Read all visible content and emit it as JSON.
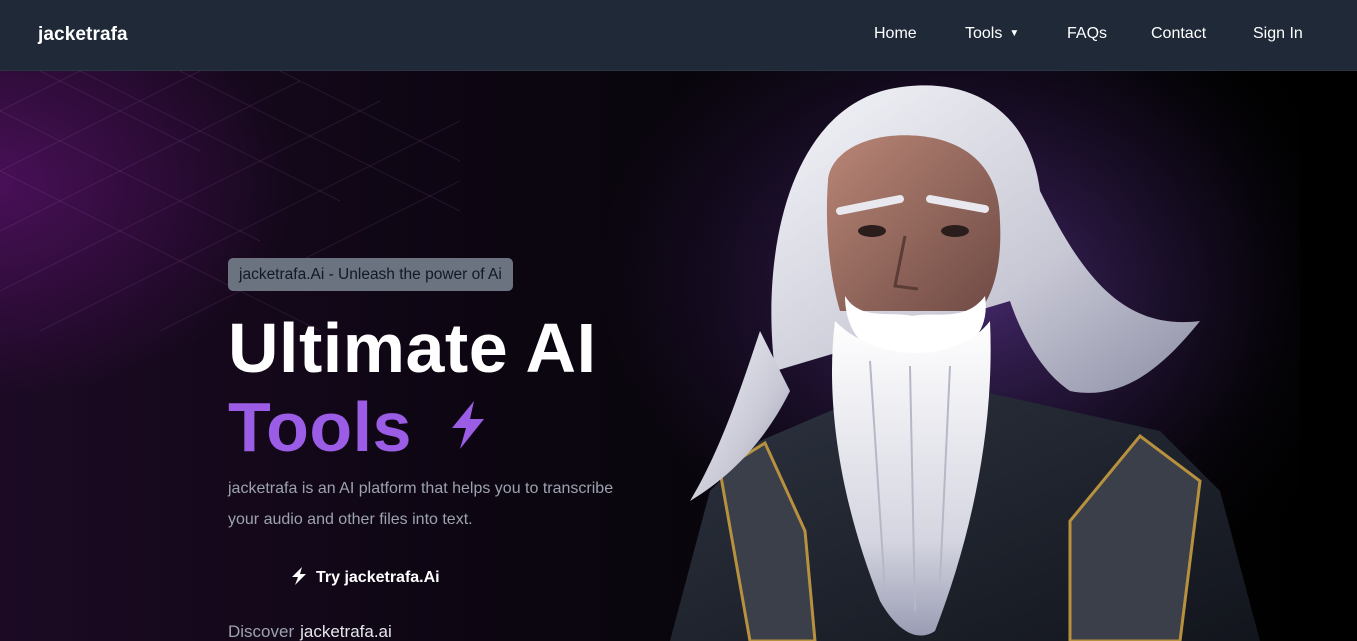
{
  "navbar": {
    "brand": "jacketrafa",
    "links": {
      "home": "Home",
      "tools": "Tools",
      "faqs": "FAQs",
      "contact": "Contact",
      "sign_in": "Sign In"
    }
  },
  "hero": {
    "badge": "jacketrafa.Ai - Unleash the power of Ai",
    "headline_line1": "Ultimate AI",
    "headline_line2": "Tools",
    "description": "jacketrafa is an AI platform that helps you to transcribe your audio and other files into text.",
    "cta_label": "Try jacketrafa.Ai",
    "discover_label": "Discover",
    "discover_link": "jacketrafa.ai"
  },
  "icons": {
    "headline_icon": "lightning-bolt-icon",
    "cta_icon": "lightning-bolt-icon",
    "tools_dropdown": "caret-down-icon"
  },
  "colors": {
    "navbar_bg": "#1f2937",
    "accent_purple": "#9b5de5",
    "badge_bg": "#6b7280",
    "muted_text": "#9ca3af"
  }
}
